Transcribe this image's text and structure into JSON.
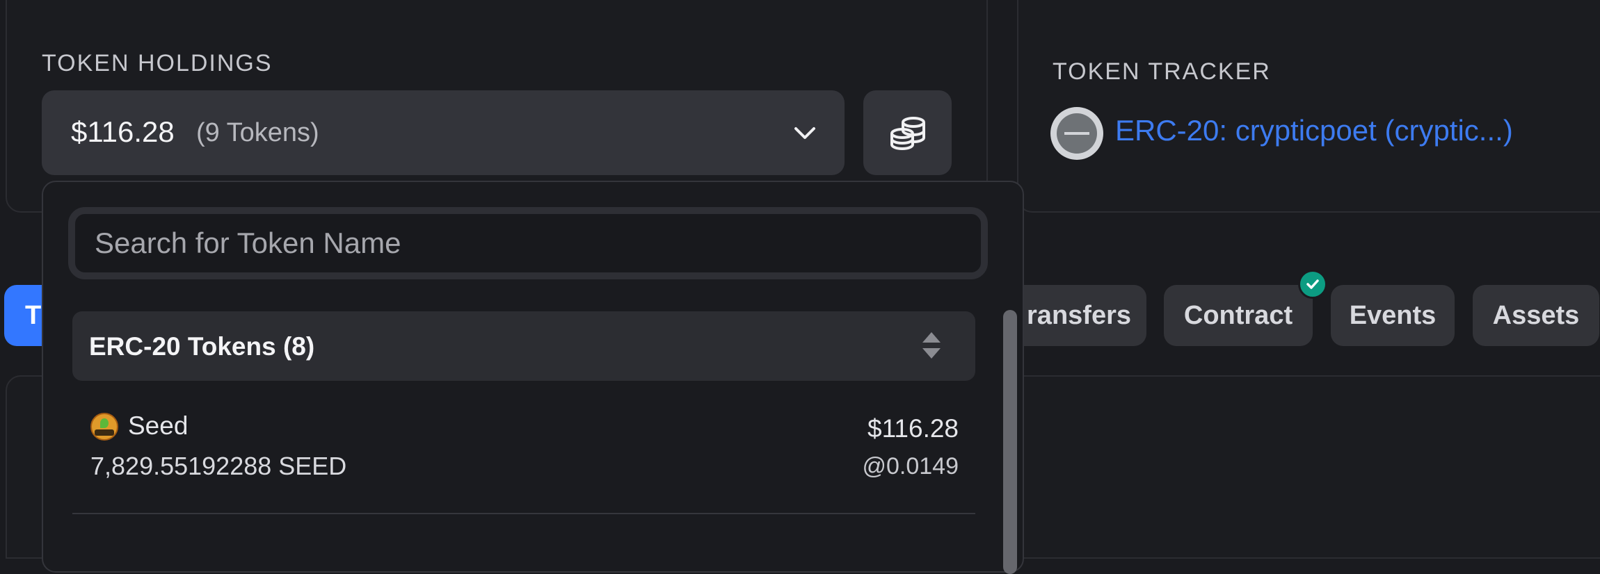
{
  "holdings": {
    "label": "TOKEN HOLDINGS",
    "value": "$116.28",
    "count": "(9 Tokens)"
  },
  "tracker": {
    "label": "TOKEN TRACKER",
    "link": "ERC-20: crypticpoet (cryptic...)"
  },
  "tabs": {
    "active": "T",
    "transfers": "ransfers",
    "contract": "Contract",
    "events": "Events",
    "assets": "Assets"
  },
  "dropdown": {
    "search_placeholder": "Search for Token Name",
    "group_title": "ERC-20 Tokens (8)",
    "tokens": [
      {
        "name": "Seed",
        "amount": "7,829.55192288 SEED",
        "value": "$116.28",
        "price": "@0.0149"
      }
    ]
  },
  "colors": {
    "accent": "#3377ff",
    "link": "#3d7bf0",
    "verified": "#0c9c82"
  }
}
